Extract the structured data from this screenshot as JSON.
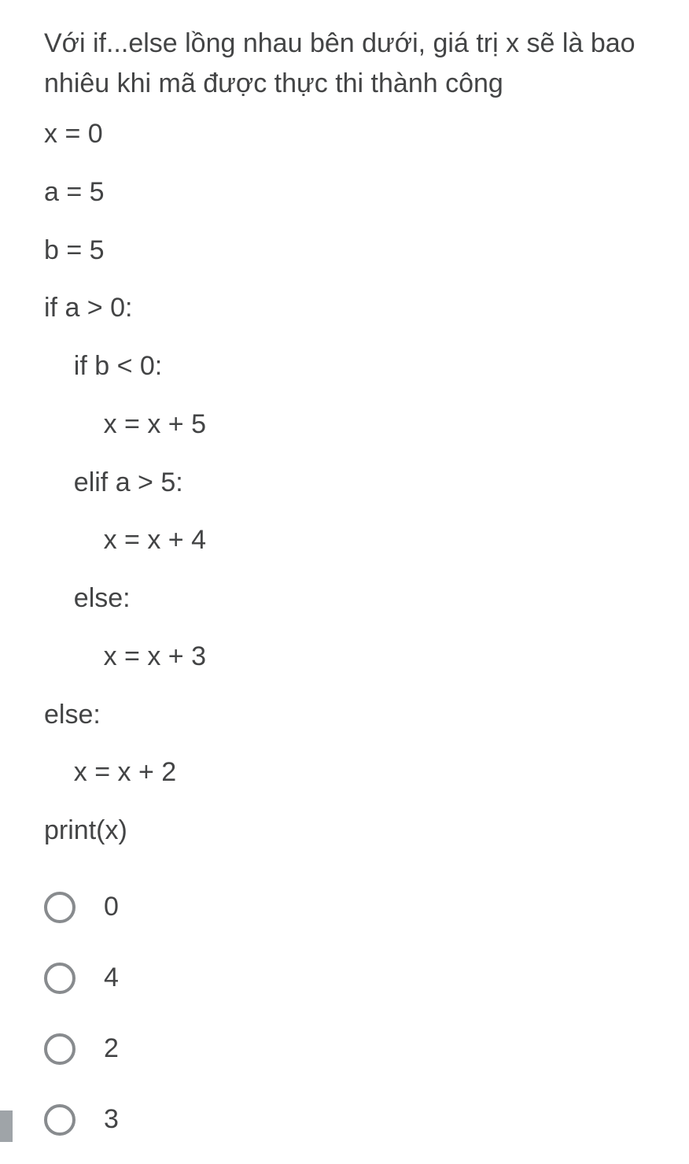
{
  "question": {
    "text": "Với if...else lồng nhau bên dưới, giá trị x sẽ là bao nhiêu khi mã được thực thi thành công"
  },
  "code": {
    "lines": [
      "x = 0",
      "a = 5",
      "b = 5",
      "if a > 0:",
      "    if b < 0:",
      "        x = x + 5",
      "    elif a > 5:",
      "        x = x + 4",
      "    else:",
      "        x = x + 3",
      "else:",
      "    x = x + 2",
      "print(x)"
    ]
  },
  "options": [
    {
      "label": "0",
      "selected": false
    },
    {
      "label": "4",
      "selected": false
    },
    {
      "label": "2",
      "selected": false
    },
    {
      "label": "3",
      "selected": false
    }
  ]
}
